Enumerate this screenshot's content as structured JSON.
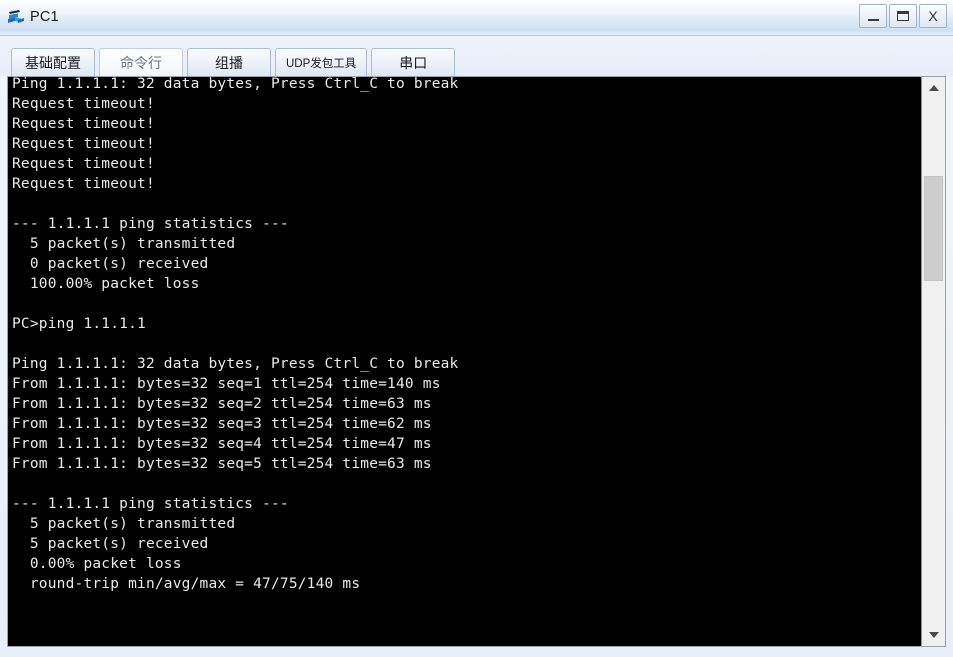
{
  "window": {
    "title": "PC1",
    "icon": "pc-device-icon",
    "controls": {
      "minimize": "–",
      "maximize": "□",
      "close": "X"
    }
  },
  "tabs": [
    {
      "label": "基础配置",
      "selected": false,
      "small": false
    },
    {
      "label": "命令行",
      "selected": true,
      "small": false
    },
    {
      "label": "组播",
      "selected": false,
      "small": false
    },
    {
      "label": "UDP发包工具",
      "selected": false,
      "small": true
    },
    {
      "label": "串口",
      "selected": false,
      "small": false
    }
  ],
  "terminal": {
    "background": "#000000",
    "foreground": "#e9e9e9",
    "lines": [
      "Ping 1.1.1.1: 32 data bytes, Press Ctrl_C to break",
      "Request timeout!",
      "Request timeout!",
      "Request timeout!",
      "Request timeout!",
      "Request timeout!",
      "",
      "--- 1.1.1.1 ping statistics ---",
      "  5 packet(s) transmitted",
      "  0 packet(s) received",
      "  100.00% packet loss",
      "",
      "PC>ping 1.1.1.1",
      "",
      "Ping 1.1.1.1: 32 data bytes, Press Ctrl_C to break",
      "From 1.1.1.1: bytes=32 seq=1 ttl=254 time=140 ms",
      "From 1.1.1.1: bytes=32 seq=2 ttl=254 time=63 ms",
      "From 1.1.1.1: bytes=32 seq=3 ttl=254 time=62 ms",
      "From 1.1.1.1: bytes=32 seq=4 ttl=254 time=47 ms",
      "From 1.1.1.1: bytes=32 seq=5 ttl=254 time=63 ms",
      "",
      "--- 1.1.1.1 ping statistics ---",
      "  5 packet(s) transmitted",
      "  5 packet(s) received",
      "  0.00% packet loss",
      "  round-trip min/avg/max = 47/75/140 ms"
    ]
  },
  "scrollbar": {
    "up_arrow": "scroll-up-icon",
    "down_arrow": "scroll-down-icon"
  }
}
